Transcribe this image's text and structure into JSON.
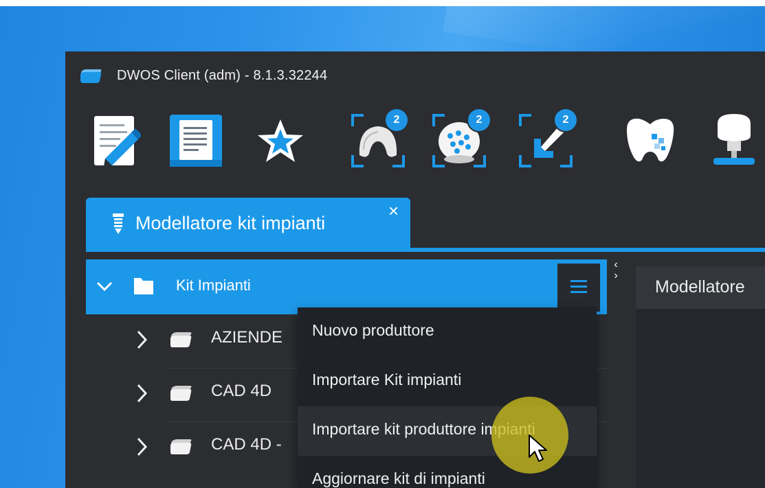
{
  "window": {
    "title": "DWOS Client (adm) - 8.1.3.32244",
    "app_logo_icon": "dwos-logo-icon"
  },
  "toolbar": {
    "buttons": [
      {
        "icon": "edit-order-icon"
      },
      {
        "icon": "order-list-icon"
      },
      {
        "icon": "star-favorite-icon"
      },
      {
        "icon": "scan-jaw-icon",
        "badge": "2"
      },
      {
        "icon": "scan-model-icon",
        "badge": "2"
      },
      {
        "icon": "import-arrow-icon",
        "badge": "2"
      },
      {
        "icon": "crown-icon"
      },
      {
        "icon": "implant-abutment-icon"
      }
    ]
  },
  "tabs": {
    "active": {
      "label": "Modellatore kit  impianti",
      "icon": "implant-icon",
      "close": "×"
    }
  },
  "tree": {
    "header": {
      "label": "Kit Impianti",
      "icon": "folder-icon"
    },
    "items": [
      {
        "label": "AZIENDE"
      },
      {
        "label": "CAD 4D"
      },
      {
        "label": "CAD 4D -"
      }
    ]
  },
  "right_panel": {
    "title": "Modellatore"
  },
  "context_menu": {
    "items": [
      {
        "label": "Nuovo produttore"
      },
      {
        "label": "Importare Kit impianti"
      },
      {
        "label": "Importare kit produttore impianti"
      },
      {
        "label": "Aggiornare kit di impianti"
      }
    ]
  },
  "colors": {
    "accent": "#1c98e8",
    "window_bg": "#2b2d31",
    "menu_bg": "#1f2226",
    "cursor_highlight": "#cabe1e"
  }
}
